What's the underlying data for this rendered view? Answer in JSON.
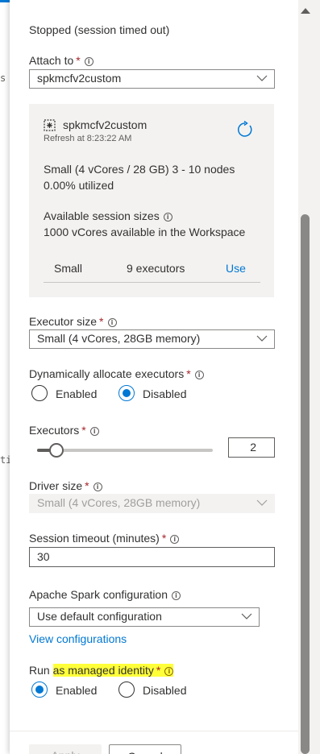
{
  "background_fragments": [
    "s",
    "ti"
  ],
  "status_text": "Stopped (session timed out)",
  "attach_to": {
    "label": "Attach to",
    "required_mark": "*",
    "selected": "spkmcfv2custom"
  },
  "pool_card": {
    "name": "spkmcfv2custom",
    "refresh_text": "Refresh at 8:23:22 AM",
    "size_line": "Small (4 vCores / 28 GB) 3 - 10 nodes",
    "utilization": "0.00% utilized",
    "available_heading": "Available session sizes",
    "available_text": "1000 vCores available in the Workspace",
    "table_row": {
      "size": "Small",
      "executors": "9 executors",
      "action": "Use"
    }
  },
  "executor_size": {
    "label": "Executor size",
    "required_mark": "*",
    "selected": "Small (4 vCores, 28GB memory)"
  },
  "dynamic_allocate": {
    "label": "Dynamically allocate executors",
    "required_mark": "*",
    "options": [
      "Enabled",
      "Disabled"
    ],
    "selected": "Disabled"
  },
  "executors": {
    "label": "Executors",
    "required_mark": "*",
    "value": "2",
    "min": 1,
    "max": 9,
    "current": 2
  },
  "driver_size": {
    "label": "Driver size",
    "required_mark": "*",
    "selected": "Small (4 vCores, 28GB memory)"
  },
  "session_timeout": {
    "label": "Session timeout (minutes)",
    "required_mark": "*",
    "value": "30"
  },
  "spark_config": {
    "label": "Apache Spark configuration",
    "selected": "Use default configuration",
    "view_link": "View configurations"
  },
  "managed_identity": {
    "label_prefix": "Run ",
    "label_highlight": "as managed identity",
    "required_mark": "*",
    "options": [
      "Enabled",
      "Disabled"
    ],
    "selected": "Enabled"
  },
  "footer": {
    "apply_label": "Apply",
    "cancel_label": "Cancel"
  },
  "colors": {
    "accent": "#0078d4",
    "highlight": "#ffff3a",
    "required": "#a4262c"
  }
}
